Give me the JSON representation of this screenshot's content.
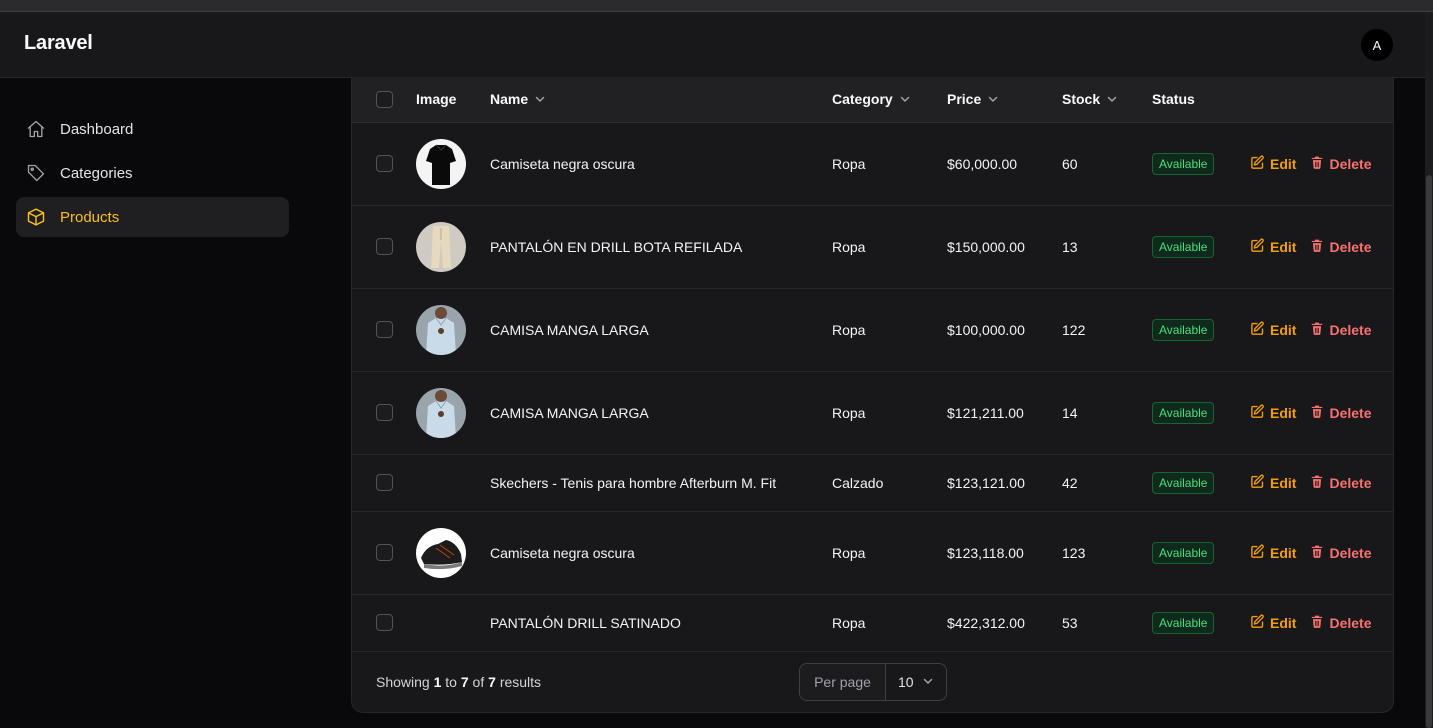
{
  "app": {
    "brand": "Laravel",
    "avatar_initial": "A"
  },
  "sidebar": {
    "items": [
      {
        "label": "Dashboard",
        "icon": "home-icon",
        "active": false
      },
      {
        "label": "Categories",
        "icon": "tag-icon",
        "active": false
      },
      {
        "label": "Products",
        "icon": "cube-icon",
        "active": true
      }
    ]
  },
  "table": {
    "headers": {
      "image": "Image",
      "name": "Name",
      "category": "Category",
      "price": "Price",
      "stock": "Stock",
      "status": "Status"
    },
    "edit_label": "Edit",
    "delete_label": "Delete",
    "rows": [
      {
        "name": "Camiseta negra oscura",
        "category": "Ropa",
        "price": "$60,000.00",
        "stock": "60",
        "status": "Available",
        "image": "black-shirt"
      },
      {
        "name": "PANTALÓN EN DRILL BOTA REFILADA",
        "category": "Ropa",
        "price": "$150,000.00",
        "stock": "13",
        "status": "Available",
        "image": "beige-pants"
      },
      {
        "name": "CAMISA MANGA LARGA",
        "category": "Ropa",
        "price": "$100,000.00",
        "stock": "122",
        "status": "Available",
        "image": "blue-shirt"
      },
      {
        "name": "CAMISA MANGA LARGA",
        "category": "Ropa",
        "price": "$121,211.00",
        "stock": "14",
        "status": "Available",
        "image": "blue-shirt"
      },
      {
        "name": "Skechers - Tenis para hombre Afterburn M. Fit",
        "category": "Calzado",
        "price": "$123,121.00",
        "stock": "42",
        "status": "Available",
        "image": ""
      },
      {
        "name": "Camiseta negra oscura",
        "category": "Ropa",
        "price": "$123,118.00",
        "stock": "123",
        "status": "Available",
        "image": "sneaker"
      },
      {
        "name": "PANTALÓN DRILL SATINADO",
        "category": "Ropa",
        "price": "$422,312.00",
        "stock": "53",
        "status": "Available",
        "image": ""
      }
    ]
  },
  "pagination": {
    "showing_prefix": "Showing",
    "from": "1",
    "to_word": "to",
    "to": "7",
    "of_word": "of",
    "total": "7",
    "results_word": "results",
    "per_page_label": "Per page",
    "per_page_value": "10"
  },
  "colors": {
    "accent": "#fbbf24",
    "edit": "#f59e0b",
    "delete": "#f87171",
    "status_available": "#4ade80",
    "background": "#09090b",
    "card": "#18181b"
  }
}
